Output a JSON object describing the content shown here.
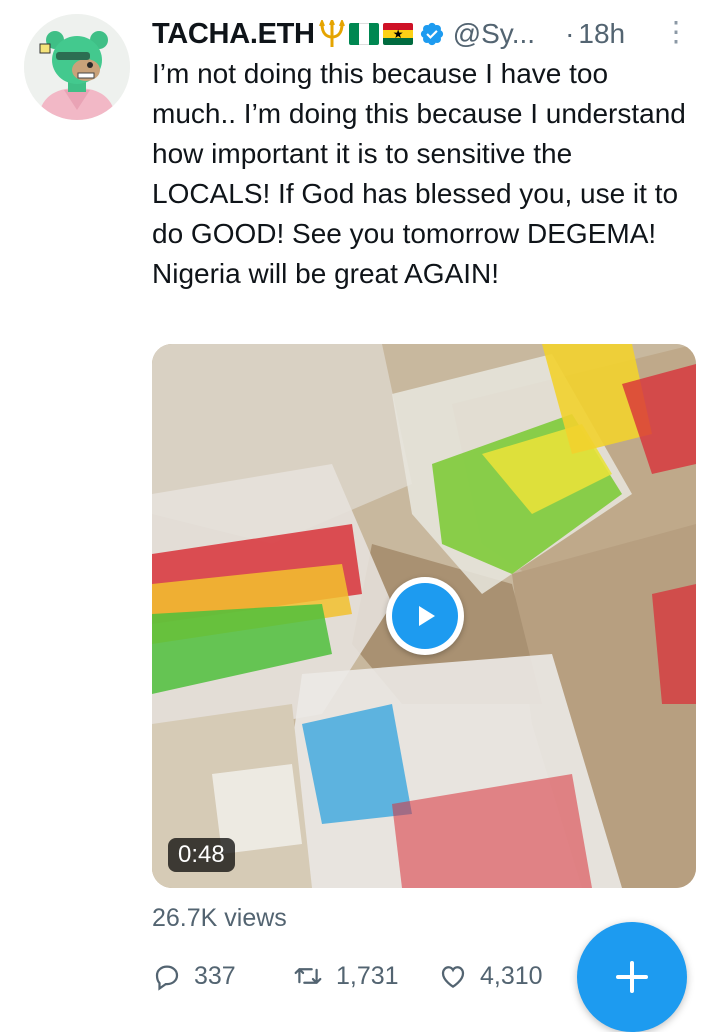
{
  "tweet": {
    "author_name": "TACHA.ETH",
    "handle": "@Sy...",
    "separator": "·",
    "time": "18h",
    "more_glyph": "⋮",
    "text": "I’m not doing this because I have too much.. I’m doing this because I understand how important it is to sensitive the LOCALS! If God has blessed you, use it to do GOOD! See you tomorrow DEGEMA! Nigeria will be great AGAIN!",
    "name_icons": [
      "trident-icon",
      "nigeria-flag-icon",
      "ghana-flag-icon",
      "verified-badge-icon"
    ]
  },
  "media": {
    "type": "video",
    "duration": "0:48"
  },
  "stats": {
    "views": "26.7K views",
    "replies": "337",
    "retweets": "1,731",
    "likes": "4,310"
  },
  "colors": {
    "accent": "#1d9bf0",
    "text": "#0f1419",
    "muted": "#536471"
  }
}
